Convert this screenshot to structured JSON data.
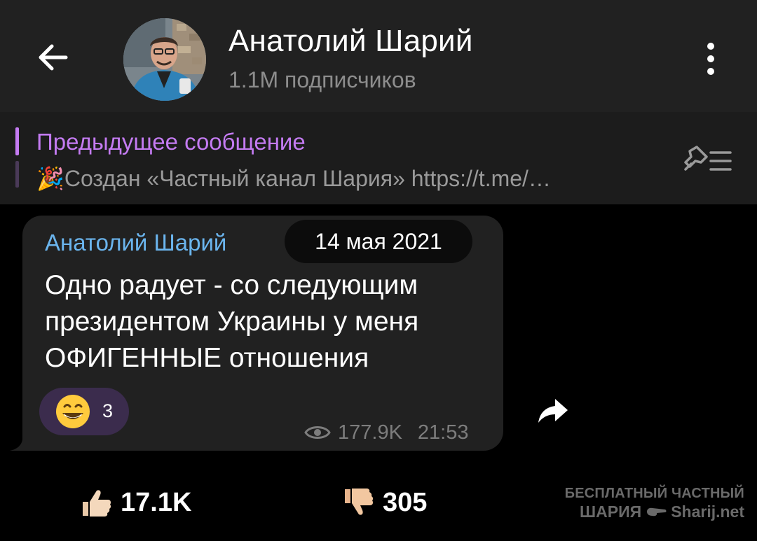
{
  "header": {
    "title": "Анатолий Шарий",
    "subtitle": "1.1M подписчиков",
    "back_icon": "arrow-left-icon",
    "menu_icon": "more-vertical-icon"
  },
  "pinned": {
    "title": "Предыдущее сообщение",
    "text": "Создан «Частный канал Шария»  https://t.me/…",
    "emoji": "🎉",
    "icon": "pinned-list-icon",
    "accent": "#c47bf2"
  },
  "message": {
    "sender": "Анатолий Шарий",
    "date": "14 мая 2021",
    "lines": [
      "Одно радует - со следующим",
      "президентом Украины у меня",
      "ОФИГЕННЫЕ отношения"
    ],
    "reaction": {
      "emoji": "😁",
      "count": "3"
    },
    "views": "177.9K",
    "time": "21:53",
    "view_icon": "eye-icon",
    "forward_icon": "share-forward-icon"
  },
  "votes": {
    "likes": "17.1K",
    "dislikes": "305",
    "like_icon": "thumbs-up-icon",
    "dislike_icon": "thumbs-down-icon"
  },
  "watermark": {
    "line1": "БЕСПЛАТНЫЙ ЧАСТНЫЙ",
    "line2_left": "ШАРИЯ",
    "line2_right": "Sharij.net"
  },
  "colors": {
    "background": "#000000",
    "header": "#212121",
    "pinned_bg": "#1c1c1c",
    "bubble": "#212121",
    "sender": "#6bb5ee",
    "reaction_bg": "#3b2c4d"
  }
}
